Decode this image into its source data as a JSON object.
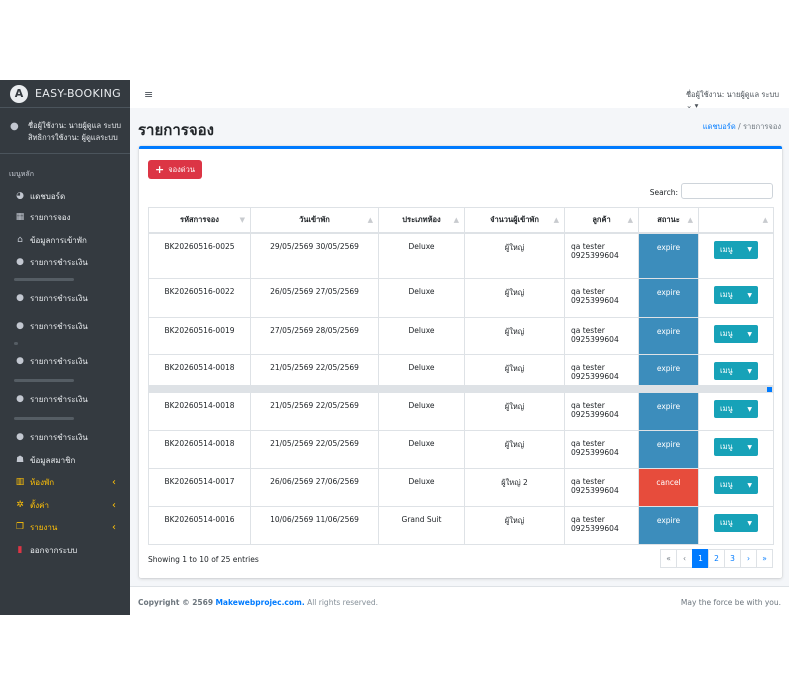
{
  "brand": {
    "logo": "A",
    "name": "EASY-BOOKING"
  },
  "user_panel": {
    "line1": "ชื่อผู้ใช้งาน: นายผู้ดูแล ระบบ",
    "line2": "สิทธิการใช้งาน: ผู้ดูแลระบบ"
  },
  "sidebar": {
    "menu_header": "เมนูหลัก",
    "items": [
      {
        "label": "แดชบอร์ด",
        "icon": "dashboard-icon",
        "glyph": "◕"
      },
      {
        "label": "รายการจอง",
        "icon": "calendar-icon",
        "glyph": "▦"
      },
      {
        "label": "ข้อมูลการเข้าพัก",
        "icon": "home-icon",
        "glyph": "⌂"
      },
      {
        "label": "รายการชำระเงิน",
        "icon": "payment-icon",
        "glyph": "●"
      },
      {
        "label": "รายการชำระเงิน",
        "icon": "payment-icon",
        "glyph": "●"
      },
      {
        "label": "รายการชำระเงิน",
        "icon": "payment-icon",
        "glyph": "●"
      },
      {
        "label": "รายการชำระเงิน",
        "icon": "payment-icon",
        "glyph": "●"
      },
      {
        "label": "รายการชำระเงิน",
        "icon": "payment-icon",
        "glyph": "●"
      },
      {
        "label": "รายการชำระเงิน",
        "icon": "payment-icon",
        "glyph": "●"
      },
      {
        "label": "ข้อมูลสมาชิก",
        "icon": "users-icon",
        "glyph": "☗"
      },
      {
        "label": "ห้องพัก",
        "icon": "building-icon",
        "glyph": "▥"
      },
      {
        "label": "ตั้งค่า",
        "icon": "gears-icon",
        "glyph": "✲"
      },
      {
        "label": "รายงาน",
        "icon": "copy-icon",
        "glyph": "❐"
      },
      {
        "label": "ออกจากระบบ",
        "icon": "logout-icon",
        "glyph": "▮"
      }
    ]
  },
  "topnav": {
    "hamburger": "≡",
    "user_text": "ชื่อผู้ใช้งาน: นายผู้ดูแล ระบบ",
    "user_caret": "⌄ ▾"
  },
  "page": {
    "title": "รายการจอง",
    "breadcrumb_home": "แดชบอร์ด",
    "breadcrumb_sep": " / ",
    "breadcrumb_current": "รายการจอง"
  },
  "card": {
    "add_button": "จองด่วน",
    "add_plus": "+",
    "search_label": "Search:",
    "search_value": ""
  },
  "table": {
    "columns": [
      "รหัสการจอง",
      "วันเข้าพัก",
      "ประเภทห้อง",
      "จำนวนผู้เข้าพัก",
      "ลูกค้า",
      "สถานะ",
      ""
    ],
    "rows": [
      {
        "code": "BK20260516-0025",
        "dates": "29/05/2569 30/05/2569",
        "room": "Deluxe",
        "guests": "ผู้ใหญ่",
        "customer": "qa tester",
        "phone": "0925399604",
        "status": "expire",
        "menu": "เมนู"
      },
      {
        "code": "BK20260516-0022",
        "dates": "26/05/2569 27/05/2569",
        "room": "Deluxe",
        "guests": "ผู้ใหญ่",
        "customer": "qa tester",
        "phone": "0925399604",
        "status": "expire",
        "menu": "เมนู"
      },
      {
        "code": "BK20260516-0019",
        "dates": "27/05/2569 28/05/2569",
        "room": "Deluxe",
        "guests": "ผู้ใหญ่",
        "customer": "qa tester",
        "phone": "0925399604",
        "status": "expire",
        "menu": "เมนู"
      },
      {
        "code": "BK20260514-0018",
        "dates": "21/05/2569 22/05/2569",
        "room": "Deluxe",
        "guests": "ผู้ใหญ่",
        "customer": "qa tester",
        "phone": "0925399604",
        "status": "expire",
        "menu": "เมนู"
      },
      {
        "code": "BK20260514-0018",
        "dates": "21/05/2569 22/05/2569",
        "room": "Deluxe",
        "guests": "ผู้ใหญ่",
        "customer": "qa tester",
        "phone": "0925399604",
        "status": "expire",
        "menu": "เมนู"
      },
      {
        "code": "BK20260514-0018",
        "dates": "21/05/2569 22/05/2569",
        "room": "Deluxe",
        "guests": "ผู้ใหญ่",
        "customer": "qa tester",
        "phone": "0925399604",
        "status": "expire",
        "menu": "เมนู"
      },
      {
        "code": "BK20260514-0017",
        "dates": "26/06/2569 27/06/2569",
        "room": "Deluxe",
        "guests": "ผู้ใหญ่ 2",
        "customer": "qa tester",
        "phone": "0925399604",
        "status": "cancel",
        "menu": "เมนู"
      },
      {
        "code": "BK20260514-0016",
        "dates": "10/06/2569 11/06/2569",
        "room": "Grand Suit",
        "guests": "ผู้ใหญ่",
        "customer": "qa tester",
        "phone": "0925399604",
        "status": "expire",
        "menu": "เมนู"
      }
    ]
  },
  "pagination": {
    "info": "Showing 1 to 10 of 25 entries",
    "first": "«",
    "prev": "‹",
    "pages": [
      "1",
      "2",
      "3"
    ],
    "next": "›",
    "last": "»"
  },
  "footer": {
    "copyright_prefix": "Copyright © 2569",
    "copyright_link": "Makewebprojec.com.",
    "copyright_suffix": "All rights reserved.",
    "right_text": "May the force be with you."
  },
  "colors": {
    "sidebar_bg": "#343a40",
    "accent": "#007bff",
    "add_button": "#dc3545",
    "menu_button": "#17a2b8",
    "status_expire": "#3c8dbc",
    "status_cancel": "#e74c3c",
    "menu_highlight": "#ffc107"
  }
}
